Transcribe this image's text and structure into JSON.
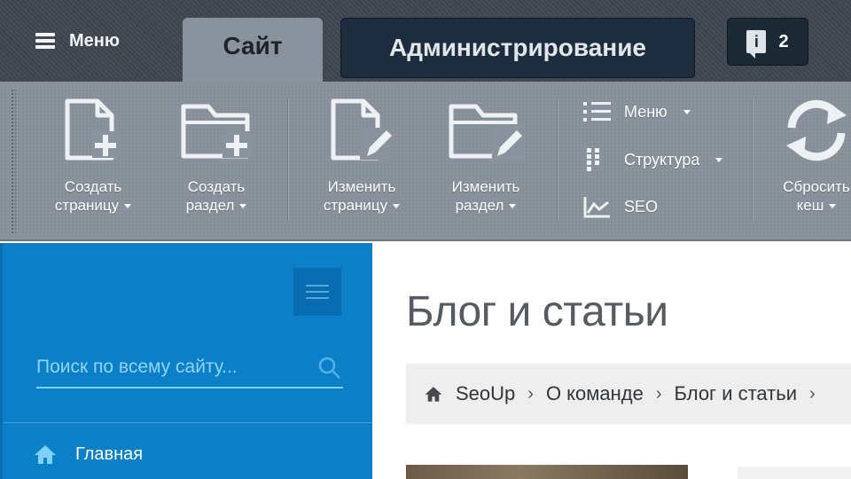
{
  "topbar": {
    "menu_label": "Меню",
    "tab_site": "Сайт",
    "tab_admin": "Администрирование",
    "notifications_count": "2",
    "notification_icon_letter": "i"
  },
  "toolbar": {
    "buttons": [
      {
        "line1": "Создать",
        "line2": "страницу",
        "icon": "new-page-icon"
      },
      {
        "line1": "Создать",
        "line2": "раздел",
        "icon": "new-folder-icon"
      },
      {
        "line1": "Изменить",
        "line2": "страницу",
        "icon": "edit-page-icon"
      },
      {
        "line1": "Изменить",
        "line2": "раздел",
        "icon": "edit-folder-icon"
      },
      {
        "line1": "Сбросить",
        "line2": "кеш",
        "icon": "refresh-icon"
      }
    ],
    "list": [
      {
        "label": "Меню",
        "icon": "list-icon",
        "has_dropdown": true
      },
      {
        "label": "Структура",
        "icon": "structure-icon",
        "has_dropdown": true
      },
      {
        "label": "SEO",
        "icon": "seo-chart-icon",
        "has_dropdown": false
      }
    ]
  },
  "sidebar": {
    "search_placeholder": "Поиск по всему сайту...",
    "nav_home": "Главная"
  },
  "content": {
    "title": "Блог и статьи",
    "breadcrumb": [
      "SeoUp",
      "О команде",
      "Блог и статьи"
    ]
  },
  "colors": {
    "topbar": "#3f4650",
    "toolbar": "#8a939d",
    "admin_tab": "#1e2d3d",
    "sidebar": "#0b80c6",
    "search_accent": "#8fd4ff"
  }
}
